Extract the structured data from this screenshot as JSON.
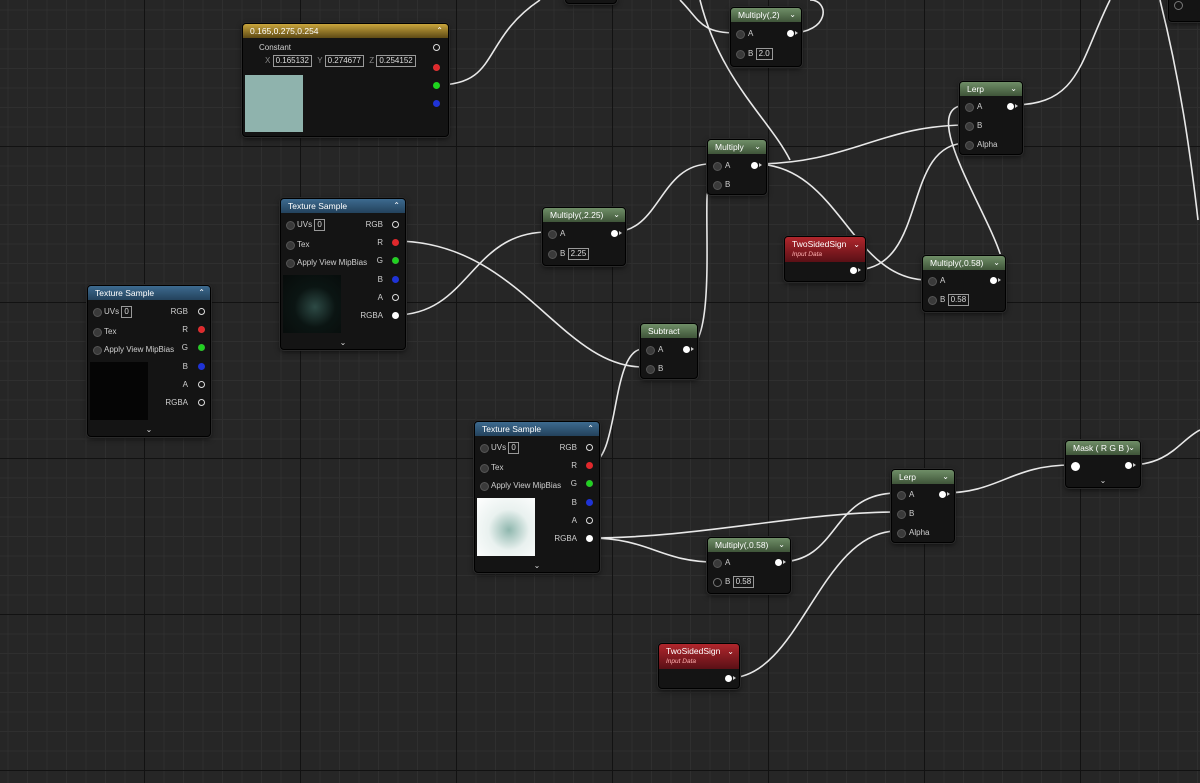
{
  "nodes": {
    "constant3": {
      "title": "0.165,0.275,0.254",
      "label": "Constant",
      "x_label": "X",
      "x_value": "0.165132",
      "y_label": "Y",
      "y_value": "0.274677",
      "z_label": "Z",
      "z_value": "0.254152",
      "swatch_color": "#8fb3ad"
    },
    "tex_left": {
      "title": "Texture Sample",
      "uvs_label": "UVs",
      "uvs_value": "0",
      "tex_label": "Tex",
      "mip_label": "Apply View MipBias",
      "out_rgb": "RGB",
      "out_r": "R",
      "out_g": "G",
      "out_b": "B",
      "out_a": "A",
      "out_rgba": "RGBA"
    },
    "tex_mid": {
      "title": "Texture Sample",
      "uvs_label": "UVs",
      "uvs_value": "0",
      "tex_label": "Tex",
      "mip_label": "Apply View MipBias",
      "out_rgb": "RGB",
      "out_r": "R",
      "out_g": "G",
      "out_b": "B",
      "out_a": "A",
      "out_rgba": "RGBA"
    },
    "tex_bottom": {
      "title": "Texture Sample",
      "uvs_label": "UVs",
      "uvs_value": "0",
      "tex_label": "Tex",
      "mip_label": "Apply View MipBias",
      "out_rgb": "RGB",
      "out_r": "R",
      "out_g": "G",
      "out_b": "B",
      "out_a": "A",
      "out_rgba": "RGBA"
    },
    "multiply_2": {
      "title": "Multiply(,2)",
      "a_label": "A",
      "b_label": "B",
      "b_value": "2.0"
    },
    "multiply_225": {
      "title": "Multiply(,2.25)",
      "a_label": "A",
      "b_label": "B",
      "b_value": "2.25"
    },
    "multiply_center": {
      "title": "Multiply",
      "a_label": "A",
      "b_label": "B"
    },
    "subtract": {
      "title": "Subtract",
      "a_label": "A",
      "b_label": "B"
    },
    "lerp_top": {
      "title": "Lerp",
      "a_label": "A",
      "b_label": "B",
      "alpha_label": "Alpha"
    },
    "twosided_top": {
      "title": "TwoSidedSign",
      "subtitle": "Input Data"
    },
    "multiply_058_top": {
      "title": "Multiply(,0.58)",
      "a_label": "A",
      "b_label": "B",
      "b_value": "0.58"
    },
    "mask_rgb": {
      "title": "Mask ( R G B )"
    },
    "lerp_bottom": {
      "title": "Lerp",
      "a_label": "A",
      "b_label": "B",
      "alpha_label": "Alpha"
    },
    "multiply_058_bottom": {
      "title": "Multiply(,0.58)",
      "a_label": "A",
      "b_label": "B",
      "b_value": "0.58"
    },
    "twosided_bottom": {
      "title": "TwoSidedSign",
      "subtitle": "Input Data"
    }
  },
  "colors": {
    "wire": "#e6e6e6",
    "texture_header": "#2f5676",
    "math_header": "#56704f",
    "constant_header": "#b08f30",
    "input_header": "#9a1f25"
  }
}
